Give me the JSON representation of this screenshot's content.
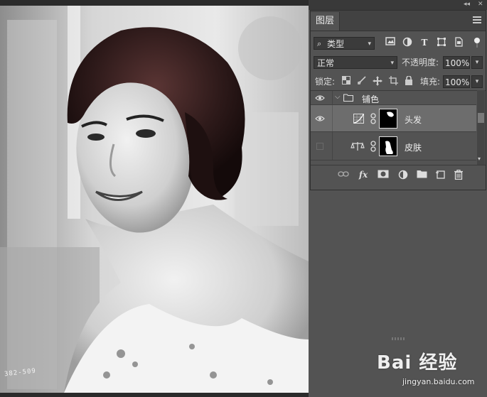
{
  "panel": {
    "tab_label": "图层",
    "filter_type": "类型",
    "blend_mode": "正常",
    "opacity_label": "不透明度:",
    "opacity_value": "100%",
    "lock_label": "锁定:",
    "fill_label": "填充:",
    "fill_value": "100%"
  },
  "layers": [
    {
      "name": "铺色",
      "kind": "group",
      "visible": true
    },
    {
      "name": "头发",
      "kind": "curves-adjustment",
      "visible": true,
      "selected": true
    },
    {
      "name": "皮肤",
      "kind": "color-balance-adjustment",
      "visible": false
    }
  ],
  "photo": {
    "caption": "382-509"
  },
  "watermark": {
    "text": "Bai 经验",
    "sub": "jingyan.baidu.com"
  },
  "colors": {
    "panel_bg": "#535353",
    "selected_row": "#6d6d6d",
    "hair_tint": "#3a2322"
  },
  "icons": [
    "filter-search-icon",
    "image-filter-icon",
    "adjustment-filter-icon",
    "type-filter-icon",
    "shape-filter-icon",
    "smart-object-filter-icon",
    "filter-toggle-icon",
    "lock-transparent-icon",
    "lock-paint-icon",
    "lock-move-icon",
    "lock-artboard-icon",
    "lock-all-icon",
    "link-layers-icon",
    "fx-icon",
    "add-mask-icon",
    "new-adjustment-icon",
    "new-group-icon",
    "new-layer-icon",
    "delete-layer-icon"
  ]
}
